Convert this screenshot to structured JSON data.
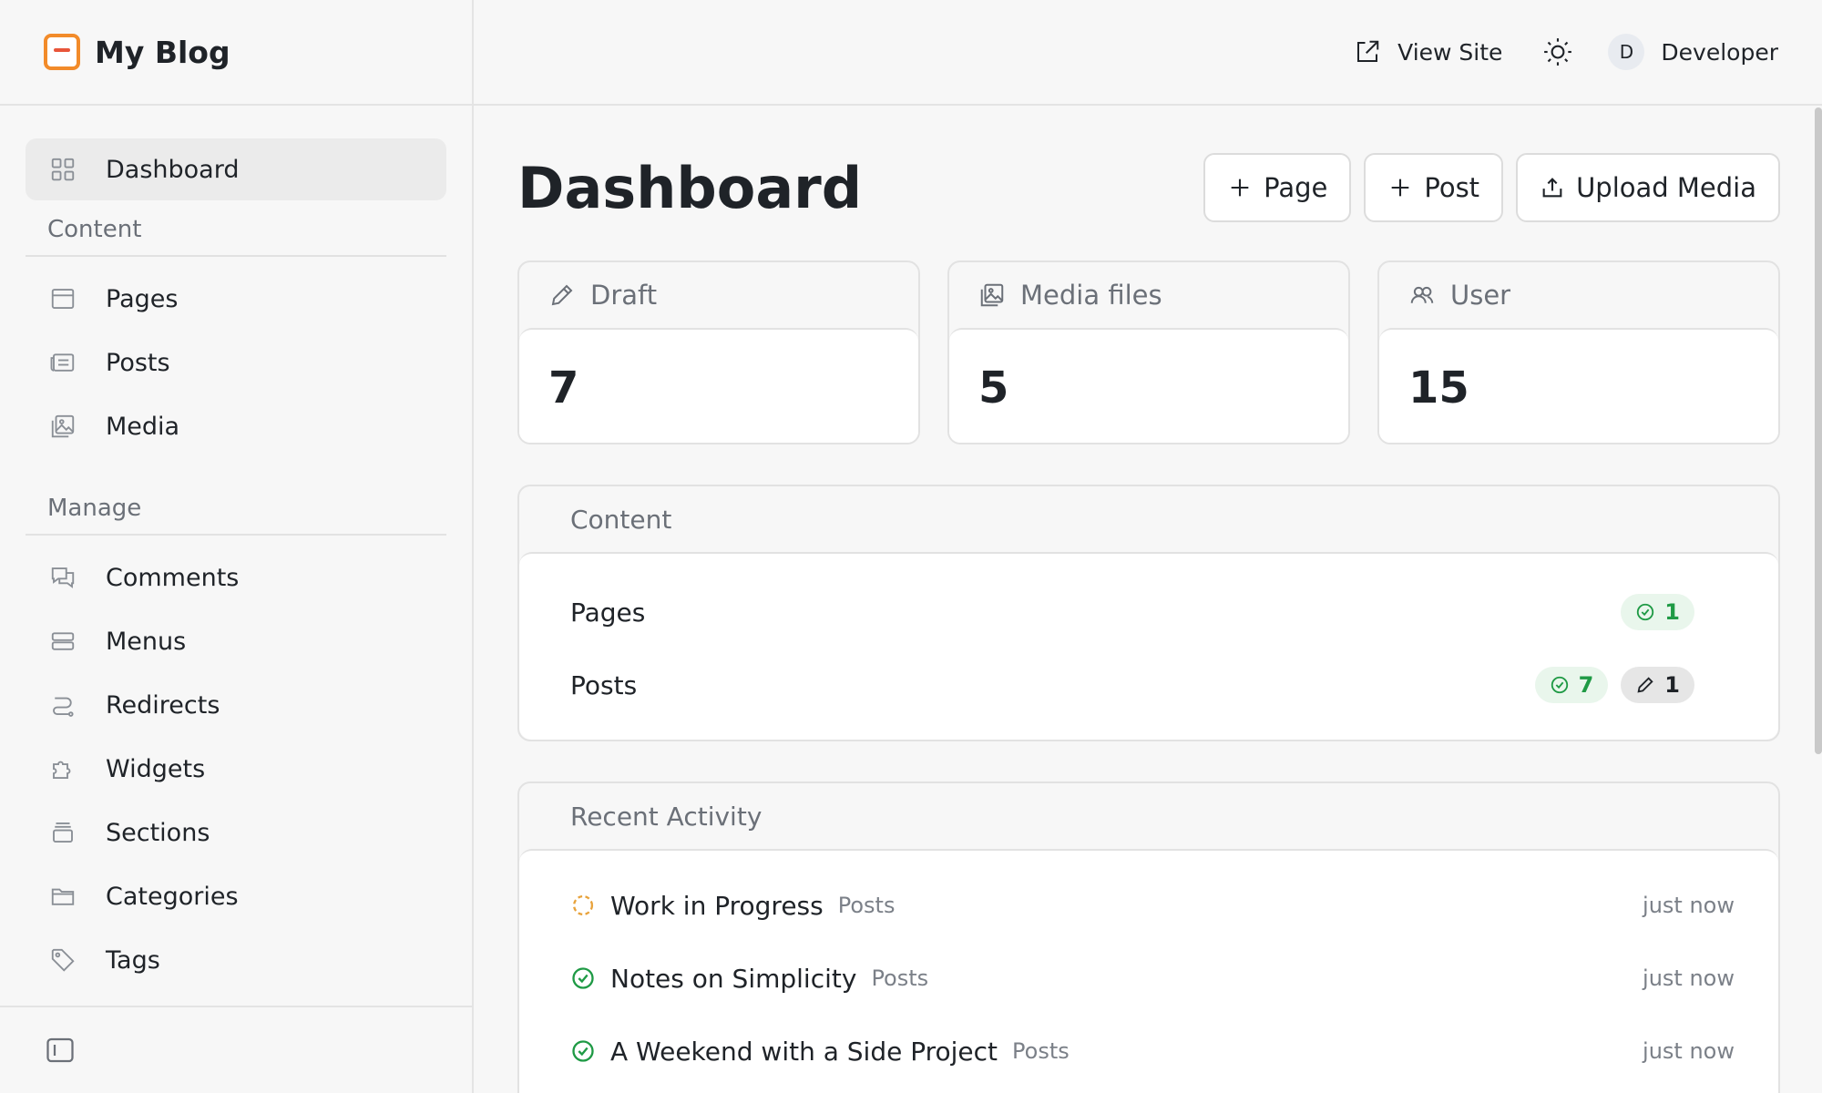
{
  "site": {
    "title": "My Blog"
  },
  "sidebar": {
    "dashboard_label": "Dashboard",
    "content_section": "Content",
    "content_items": [
      {
        "label": "Pages",
        "icon": "pages-icon"
      },
      {
        "label": "Posts",
        "icon": "posts-icon"
      },
      {
        "label": "Media",
        "icon": "media-icon"
      }
    ],
    "manage_section": "Manage",
    "manage_items": [
      {
        "label": "Comments",
        "icon": "comments-icon"
      },
      {
        "label": "Menus",
        "icon": "menus-icon"
      },
      {
        "label": "Redirects",
        "icon": "redirects-icon"
      },
      {
        "label": "Widgets",
        "icon": "widgets-icon"
      },
      {
        "label": "Sections",
        "icon": "sections-icon"
      },
      {
        "label": "Categories",
        "icon": "folder-icon"
      },
      {
        "label": "Tags",
        "icon": "tag-icon"
      }
    ]
  },
  "topbar": {
    "view_site_label": "View Site",
    "user_initial": "D",
    "user_name": "Developer"
  },
  "main": {
    "title": "Dashboard",
    "actions": {
      "page": "Page",
      "post": "Post",
      "upload": "Upload Media"
    },
    "stats": [
      {
        "label": "Draft",
        "value": "7",
        "icon": "pencil-icon"
      },
      {
        "label": "Media files",
        "value": "5",
        "icon": "image-icon"
      },
      {
        "label": "User",
        "value": "15",
        "icon": "users-icon"
      }
    ],
    "content_panel": {
      "title": "Content",
      "rows": [
        {
          "label": "Pages",
          "published": "1"
        },
        {
          "label": "Posts",
          "published": "7",
          "drafts": "1"
        }
      ]
    },
    "activity_panel": {
      "title": "Recent Activity",
      "items": [
        {
          "title": "Work in Progress",
          "type": "Posts",
          "time": "just now",
          "status": "draft"
        },
        {
          "title": "Notes on Simplicity",
          "type": "Posts",
          "time": "just now",
          "status": "published"
        },
        {
          "title": "A Weekend with a Side Project",
          "type": "Posts",
          "time": "just now",
          "status": "published"
        }
      ]
    }
  },
  "colors": {
    "accent_orange": "#f28b2a",
    "published_green": "#1f9a45",
    "draft_orange": "#e8a23a"
  }
}
